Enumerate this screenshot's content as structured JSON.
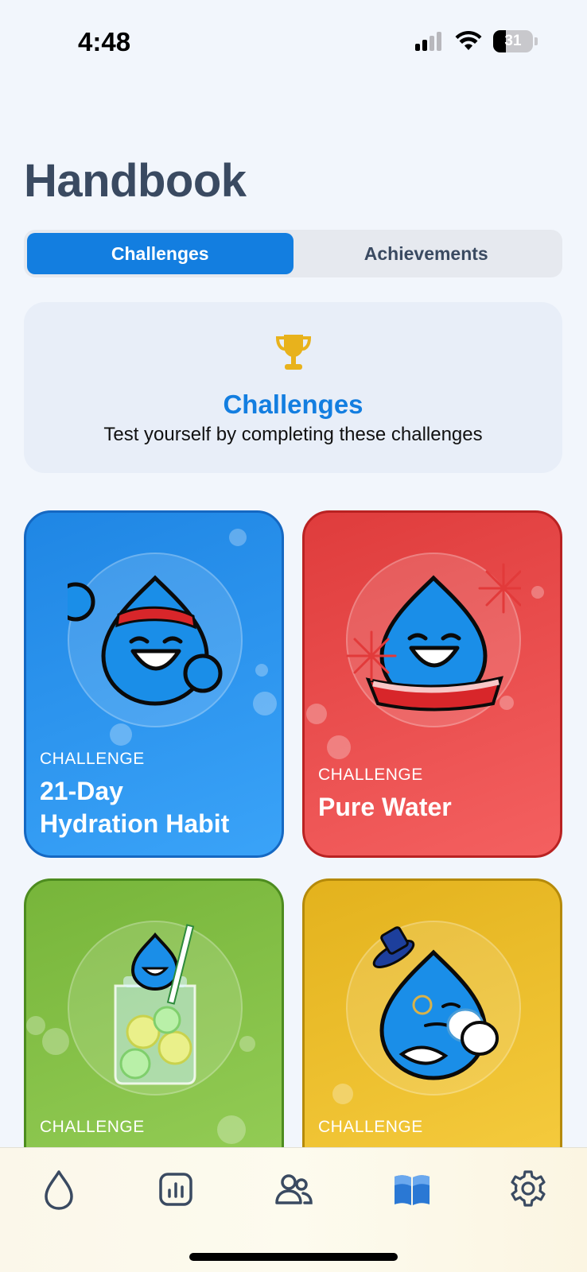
{
  "status_bar": {
    "time": "4:48",
    "battery": "31"
  },
  "header": {
    "title": "Handbook"
  },
  "segmented": {
    "tabs": [
      {
        "label": "Challenges",
        "active": true
      },
      {
        "label": "Achievements",
        "active": false
      }
    ]
  },
  "info_card": {
    "icon": "trophy-icon",
    "title": "Challenges",
    "subtitle": "Test yourself by completing these challenges"
  },
  "cards": [
    {
      "kicker": "CHALLENGE",
      "title_line1": "21-Day",
      "title_line2": "Hydration Habit",
      "color": "#2a92ee",
      "mascot": "headband-drop-icon"
    },
    {
      "kicker": "CHALLENGE",
      "title_line1": "Pure Water",
      "color": "#ea4d4d",
      "mascot": "cheerleader-drop-icon"
    },
    {
      "kicker": "CHALLENGE",
      "color": "#88c34a",
      "mascot": "infused-water-jar-icon"
    },
    {
      "kicker": "CHALLENGE",
      "color": "#f0c12f",
      "mascot": "gentleman-tea-drop-icon"
    }
  ],
  "tab_bar": {
    "items": [
      {
        "icon": "water-drop-icon",
        "active": false
      },
      {
        "icon": "stats-chart-icon",
        "active": false
      },
      {
        "icon": "friends-icon",
        "active": false
      },
      {
        "icon": "handbook-icon",
        "active": true
      },
      {
        "icon": "settings-gear-icon",
        "active": false
      }
    ]
  },
  "colors": {
    "accent": "#137ee0",
    "title": "#3a4a61",
    "background": "#f2f6fc"
  }
}
